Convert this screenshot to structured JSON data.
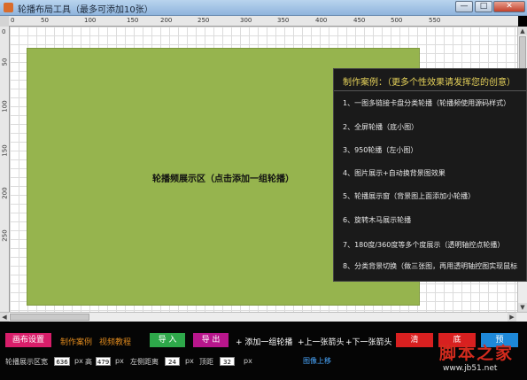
{
  "window": {
    "title": "轮播布局工具（最多可添加10张）",
    "buttons": {
      "minimize": "—",
      "maximize": "□",
      "close": "✕"
    }
  },
  "ruler": {
    "h_ticks": [
      "0",
      "50",
      "100",
      "150",
      "200",
      "250",
      "300",
      "350",
      "400",
      "450",
      "500",
      "550"
    ],
    "v_ticks": [
      "0",
      "50",
      "100",
      "150",
      "200",
      "250"
    ]
  },
  "canvas": {
    "carousel_label": "轮播频展示区（点击添加一组轮播）",
    "carousel_color": "#96b44e"
  },
  "case_panel": {
    "title": "制作案例：（更多个性效果请发挥您的创意）",
    "items": [
      "1、一图多链接卡盘分类轮播（轮播频使用源码样式）",
      "2、全屏轮播（底小图）",
      "3、950轮播（左小图）",
      "4、图片展示+自动换背景图效果",
      "5、轮播展示窗（背景图上面添加小轮播）",
      "6、旋转木马展示轮播",
      "7、180度/360度等多个度展示（透明轴控点轮播）",
      "8、分类背景切换（做三张图，再用透明轴控图实现鼠标"
    ]
  },
  "toolbar": {
    "canvas_settings": "画布设置",
    "make_cases": "制作案例",
    "video_tutorial": "视频教程",
    "import": "导 入",
    "export": "导 出",
    "add_group": "+ 添加一组轮播",
    "prev_arrow": "+上一张箭头",
    "next_arrow": "+下一张箭头",
    "clear": "清",
    "bottom": "底",
    "preview": "预"
  },
  "settings": {
    "width_label": "轮播展示区宽",
    "width_value": "636",
    "px1": "px",
    "height_label": "高",
    "height_value": "479",
    "px2": "px",
    "left_label": "左侧距离",
    "left_value": "24",
    "px3": "px",
    "top_label": "顶距",
    "top_value": "32",
    "px4": "px",
    "image_up": "图像上移"
  },
  "watermark": {
    "text": "脚本之家",
    "url": "www.jb51.net"
  },
  "colors": {
    "canvas_settings_bg": "#d81e6a",
    "import_bg": "#2ea84a",
    "export_bg": "#b8168c",
    "clear_bg": "#d82020",
    "bottom_bg": "#d82020",
    "preview_bg": "#1e88d8",
    "link_orange": "#e08a1e",
    "link_white": "#ffffff",
    "link_blue": "#4aa8ff"
  }
}
